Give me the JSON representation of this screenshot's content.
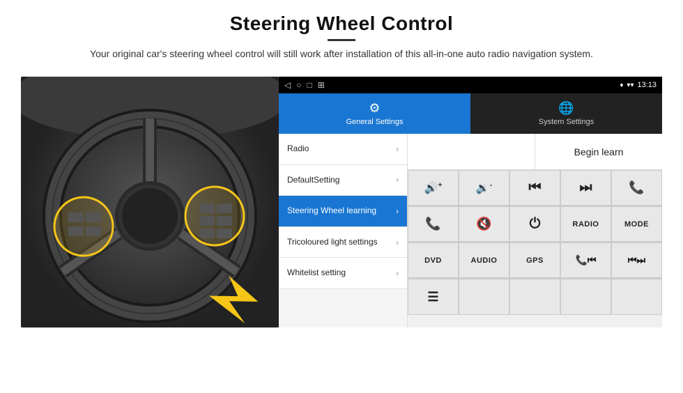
{
  "header": {
    "title": "Steering Wheel Control",
    "subtitle": "Your original car's steering wheel control will still work after installation of this all-in-one auto radio navigation system."
  },
  "status_bar": {
    "nav_icons": [
      "◁",
      "○",
      "□",
      "⊞"
    ],
    "right": {
      "location": "♦",
      "wifi": "▾",
      "signal": "▾",
      "time": "13:13"
    }
  },
  "tabs": [
    {
      "id": "general",
      "label": "General Settings",
      "icon": "⚙",
      "active": true
    },
    {
      "id": "system",
      "label": "System Settings",
      "icon": "🌐",
      "active": false
    }
  ],
  "menu": {
    "items": [
      {
        "id": "radio",
        "label": "Radio",
        "active": false
      },
      {
        "id": "default",
        "label": "DefaultSetting",
        "active": false
      },
      {
        "id": "steering",
        "label": "Steering Wheel learning",
        "active": true
      },
      {
        "id": "tricolour",
        "label": "Tricoloured light settings",
        "active": false
      },
      {
        "id": "whitelist",
        "label": "Whitelist setting",
        "active": false
      }
    ]
  },
  "controls": {
    "begin_learn_label": "Begin learn",
    "grid_row1": [
      {
        "id": "vol-up",
        "icon": "🔊+",
        "type": "icon"
      },
      {
        "id": "vol-down",
        "icon": "🔉-",
        "type": "icon"
      },
      {
        "id": "prev-track",
        "icon": "⏮",
        "type": "icon"
      },
      {
        "id": "next-track",
        "icon": "⏭",
        "type": "icon"
      },
      {
        "id": "phone",
        "icon": "📞",
        "type": "icon"
      }
    ],
    "grid_row2": [
      {
        "id": "answer",
        "icon": "📞",
        "type": "icon"
      },
      {
        "id": "mute",
        "icon": "🔇",
        "type": "icon"
      },
      {
        "id": "power",
        "icon": "⏻",
        "type": "icon"
      },
      {
        "id": "radio-btn",
        "label": "RADIO",
        "type": "text"
      },
      {
        "id": "mode-btn",
        "label": "MODE",
        "type": "text"
      }
    ],
    "bottom_row": [
      {
        "id": "dvd",
        "label": "DVD"
      },
      {
        "id": "audio",
        "label": "AUDIO"
      },
      {
        "id": "gps",
        "label": "GPS"
      },
      {
        "id": "phone2",
        "icon": "📞⏮",
        "label": "☎⏮"
      },
      {
        "id": "prev2",
        "label": "⏮⏭"
      }
    ],
    "last_item": {
      "id": "list-icon",
      "icon": "☰"
    }
  }
}
